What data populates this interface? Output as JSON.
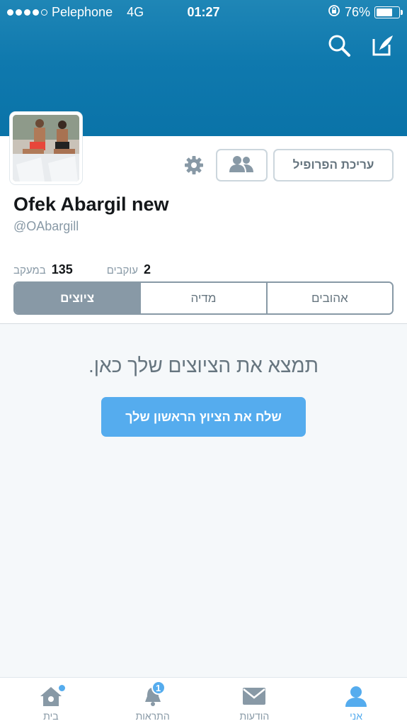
{
  "status_bar": {
    "carrier": "Pelephone",
    "network": "4G",
    "time": "01:27",
    "battery": "76%",
    "battery_level": 0.76
  },
  "header": {
    "icons": [
      "search-icon",
      "compose-icon"
    ]
  },
  "profile": {
    "name": "Ofek Abargil new",
    "handle": "@OAbargill",
    "edit_profile_label": "עריכת הפרופיל",
    "stats": {
      "following_count": "135",
      "following_label": "במעקב",
      "followers_count": "2",
      "followers_label": "עוקבים"
    },
    "tabs": [
      {
        "label": "ציוצים",
        "active": true
      },
      {
        "label": "מדיה",
        "active": false
      },
      {
        "label": "אהובים",
        "active": false
      }
    ]
  },
  "empty_state": {
    "message": "תמצא את הציוצים שלך כאן.",
    "cta_label": "שלח את הציוץ הראשון שלך"
  },
  "tabbar": {
    "items": [
      {
        "label": "בית",
        "icon": "home-icon"
      },
      {
        "label": "התראות",
        "icon": "bell-icon",
        "badge": "1"
      },
      {
        "label": "הודעות",
        "icon": "envelope-icon"
      },
      {
        "label": "אני",
        "icon": "person-icon",
        "active": true
      }
    ]
  },
  "colors": {
    "accent": "#55acee",
    "banner": "#0f79ae",
    "muted": "#8899a6"
  }
}
